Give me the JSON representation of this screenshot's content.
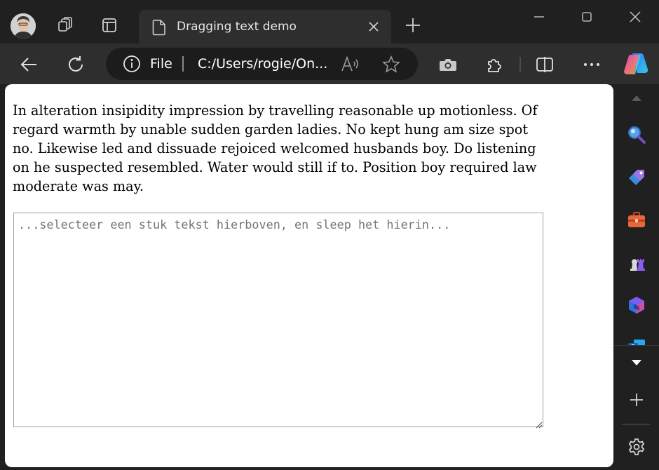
{
  "tab": {
    "title": "Dragging text demo"
  },
  "address_bar": {
    "scheme_label": "File",
    "url": "C:/Users/rogie/On..."
  },
  "page": {
    "paragraph": "In alteration insipidity impression by travelling reasonable up motionless. Of regard warmth by unable sudden garden ladies. No kept hung am size spot no. Likewise led and dissuade rejoiced welcomed husbands boy. Do listening on he suspected resembled. Water would still if to. Position boy required law moderate was may.",
    "textarea": {
      "value": "",
      "placeholder": "...selecteer een stuk tekst hierboven, en sleep het hierin..."
    }
  },
  "icons": {
    "titlebar": [
      "avatar",
      "workspaces-icon",
      "tab-actions-icon",
      "page-icon",
      "close-tab-icon",
      "new-tab-icon",
      "minimize-icon",
      "maximize-icon",
      "window-close-icon"
    ],
    "toolbar": [
      "back-icon",
      "refresh-icon",
      "info-icon",
      "read-aloud-icon",
      "favorite-star-icon",
      "screenshot-icon",
      "extensions-icon",
      "split-screen-icon",
      "more-icon",
      "copilot-icon"
    ],
    "sidebar": [
      "scroll-up-icon",
      "search-icon",
      "shopping-tag-icon",
      "tools-briefcase-icon",
      "games-icon",
      "microsoft-365-icon",
      "outlook-icon",
      "scroll-down-icon",
      "add-icon",
      "settings-icon"
    ]
  },
  "colors": {
    "window_bg": "#202020",
    "toolbar_bg": "#2e2e2e",
    "content_bg": "#ffffff",
    "text_light": "#e6e6e6"
  }
}
